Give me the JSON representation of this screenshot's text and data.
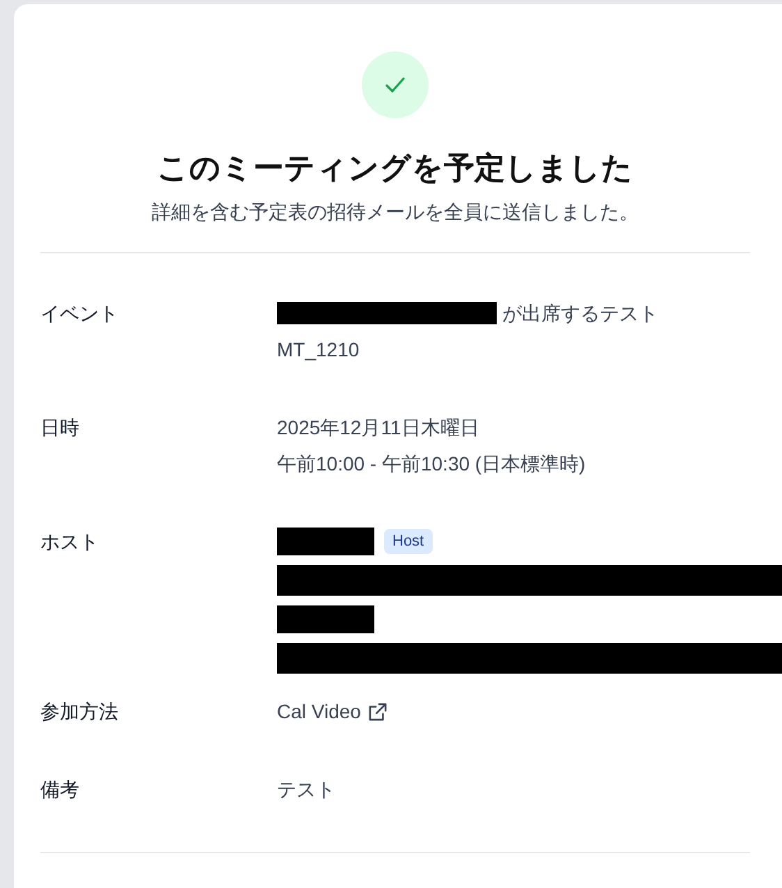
{
  "header": {
    "title": "このミーティングを予定しました",
    "subtitle": "詳細を含む予定表の招待メールを全員に送信しました。"
  },
  "rows": [
    {
      "label": "イベント",
      "lines": [
        [
          {
            "kind": "redacted_medium"
          },
          {
            "kind": "text",
            "text": "が出席するテスト"
          }
        ],
        [
          {
            "kind": "text",
            "text": "MT_1210"
          }
        ]
      ]
    },
    {
      "label": "日時",
      "lines": [
        [
          {
            "kind": "text",
            "text": "2025年12月11日木曜日"
          }
        ],
        [
          {
            "kind": "text",
            "text": "午前10:00 - 午前10:30 (日本標準時)"
          }
        ]
      ]
    },
    {
      "label": "ホスト",
      "lines": [
        [
          {
            "kind": "redacted_short"
          },
          {
            "kind": "badge",
            "text": "Host"
          }
        ],
        [
          {
            "kind": "redacted_long"
          }
        ],
        [
          {
            "kind": "redacted_short"
          }
        ],
        [
          {
            "kind": "redacted_long"
          }
        ]
      ]
    },
    {
      "label": "参加方法",
      "lines": [
        [
          {
            "kind": "link",
            "text": "Cal Video"
          }
        ]
      ]
    },
    {
      "label": "備考",
      "lines": [
        [
          {
            "kind": "text",
            "text": "テスト"
          }
        ]
      ]
    }
  ]
}
